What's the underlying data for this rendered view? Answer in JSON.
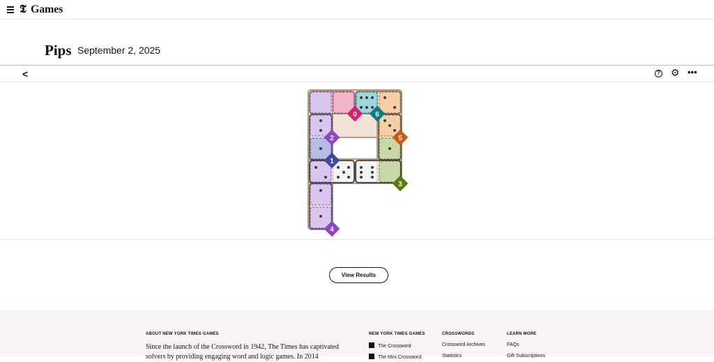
{
  "header": {
    "logo_letter": "𝕿",
    "brand": "Games"
  },
  "puzzle": {
    "title": "Pips",
    "date": "September 2, 2025"
  },
  "toolbar": {
    "back": "<",
    "help": "?",
    "settings": "⚙",
    "more": "•••"
  },
  "regions": [
    {
      "label": "0",
      "color": "#d6206f",
      "fill": "#f3b5c9"
    },
    {
      "label": "6",
      "color": "#0b7b84",
      "fill": "#9ed6dc"
    },
    {
      "label": "5",
      "color": "#d2590b",
      "fill": "#f6cfa5"
    },
    {
      "label": "2",
      "color": "#8f45c9",
      "fill": "#d9c6ee"
    },
    {
      "label": "1",
      "color": "#3d48a8",
      "fill": "#b6bde4"
    },
    {
      "label": "3",
      "color": "#5b7a10",
      "fill": "#c8d8a8"
    },
    {
      "label": "4",
      "color": "#8f45c9",
      "fill": "#d9c6ee"
    }
  ],
  "actions": {
    "view_results": "View Results"
  },
  "footer": {
    "about_heading": "ABOUT NEW YORK TIMES GAMES",
    "about_text": "Since the launch of the Crossword in 1942, The Times has captivated solvers by providing engaging word and logic games. In 2014",
    "col1_heading": "NEW YORK TIMES GAMES",
    "col1_items": [
      "The Crossword",
      "The Mini Crossword"
    ],
    "col2_heading": "CROSSWORDS",
    "col2_items": [
      "Crossword Archives",
      "Statistics"
    ],
    "col3_heading": "LEARN MORE",
    "col3_items": [
      "FAQs",
      "Gift Subscriptions"
    ]
  }
}
